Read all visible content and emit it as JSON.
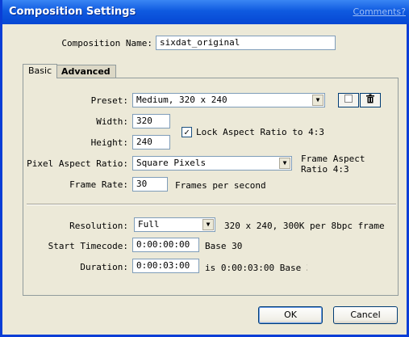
{
  "window": {
    "title": "Composition Settings",
    "comments_link": "Comments?"
  },
  "composition": {
    "name_label": "Composition Name:",
    "name_value": "sixdat_original"
  },
  "tabs": [
    {
      "label": "Basic",
      "active": true
    },
    {
      "label": "Advanced",
      "active": false
    }
  ],
  "basic": {
    "preset_label": "Preset:",
    "preset_value": "Medium, 320 x 240",
    "width_label": "Width:",
    "width_value": "320",
    "height_label": "Height:",
    "height_value": "240",
    "lock_aspect_label": "Lock Aspect Ratio to 4:3",
    "lock_aspect_checked": true,
    "pixel_aspect_label": "Pixel Aspect Ratio:",
    "pixel_aspect_value": "Square Pixels",
    "frame_aspect_line1": "Frame Aspect",
    "frame_aspect_line2": "Ratio 4:3",
    "frame_rate_label": "Frame Rate:",
    "frame_rate_value": "30",
    "frame_rate_units": "Frames per second",
    "resolution_label": "Resolution:",
    "resolution_value": "Full",
    "resolution_info": "320 x 240, 300K per 8bpc frame",
    "start_timecode_label": "Start Timecode:",
    "start_timecode_value": "0:00:00:00",
    "start_timecode_base": "Base 30",
    "duration_label": "Duration:",
    "duration_value": "0:00:03:00",
    "duration_info": "is 0:00:03:00  Base 30"
  },
  "buttons": {
    "ok": "OK",
    "cancel": "Cancel"
  },
  "icons": {
    "save_preset": "save-preset-icon",
    "delete_preset": "trash-icon"
  },
  "colors": {
    "titlebar": "#0647d3",
    "dialog_bg": "#ece9d8"
  }
}
